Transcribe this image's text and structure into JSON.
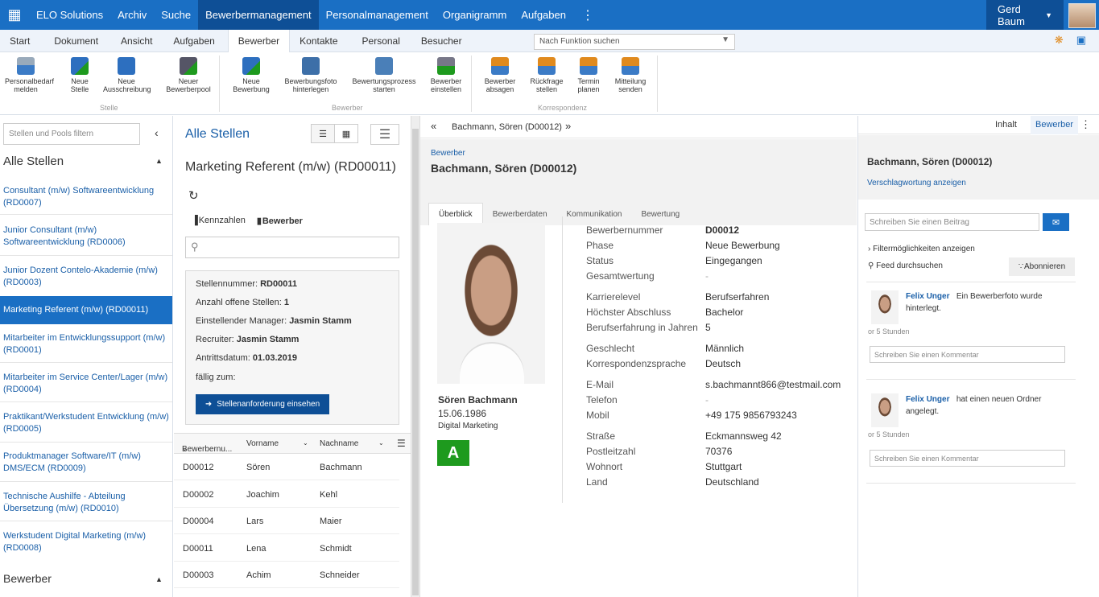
{
  "topbar": {
    "grid_icon": "apps-grid-icon",
    "nav": [
      "ELO Solutions",
      "Archiv",
      "Suche",
      "Bewerbermanagement",
      "Personalmanagement",
      "Organigramm",
      "Aufgaben"
    ],
    "active_index": 3,
    "user": "Gerd Baum"
  },
  "ribbon_tabs": [
    "Start",
    "Dokument",
    "Ansicht",
    "Aufgaben",
    "Bewerber",
    "Kontakte",
    "Personal",
    "Besucher"
  ],
  "ribbon_active_index": 4,
  "function_search": {
    "placeholder": "Nach Funktion suchen"
  },
  "ribbon": {
    "buttons": [
      {
        "label": "Personalbedarf melden",
        "icon": "person-request-icon"
      },
      {
        "label": "Neue Stelle",
        "icon": "new-position-icon"
      },
      {
        "label": "Neue Ausschreibung",
        "icon": "new-posting-icon"
      },
      {
        "label": "Neuer Bewerberpool",
        "icon": "new-pool-icon"
      },
      {
        "label": "Neue Bewerbung",
        "icon": "new-application-icon"
      },
      {
        "label": "Bewerbungsfoto hinterlegen",
        "icon": "photo-icon"
      },
      {
        "label": "Bewertungsprozess starten",
        "icon": "rating-process-icon"
      },
      {
        "label": "Bewerber einstellen",
        "icon": "hire-icon"
      },
      {
        "label": "Bewerber absagen",
        "icon": "reject-icon"
      },
      {
        "label": "Rückfrage stellen",
        "icon": "question-icon"
      },
      {
        "label": "Termin planen",
        "icon": "calendar-icon"
      },
      {
        "label": "Mitteilung senden",
        "icon": "message-icon"
      }
    ],
    "groups": [
      "Stelle",
      "Bewerber",
      "Korrespondenz"
    ]
  },
  "left": {
    "filter_placeholder": "Stellen und Pools filtern",
    "header": "Alle Stellen",
    "items": [
      "Consultant (m/w) Softwareentwicklung (RD0007)",
      "Junior Consultant (m/w) Softwareentwicklung (RD0006)",
      "Junior Dozent Contelo-Akademie (m/w) (RD0003)",
      "Marketing Referent (m/w) (RD00011)",
      "Mitarbeiter im Entwicklungssupport (m/w) (RD0001)",
      "Mitarbeiter im Service Center/Lager (m/w) (RD0004)",
      "Praktikant/Werkstudent Entwicklung (m/w) (RD0005)",
      "Produktmanager Software/IT (m/w) DMS/ECM (RD0009)",
      "Technische Aushilfe - Abteilung Übersetzung (m/w) (RD0010)",
      "Werkstudent Digital Marketing (m/w) (RD0008)"
    ],
    "selected_index": 3,
    "footer_header": "Bewerber"
  },
  "middle": {
    "title": "Alle Stellen",
    "job_title": "Marketing Referent (m/w) (RD00011)",
    "link_kennzahlen": "Kennzahlen",
    "link_bewerber": "Bewerber",
    "card": {
      "stellennummer_label": "Stellennummer:",
      "stellennummer": "RD00011",
      "offene_label": "Anzahl offene Stellen:",
      "offene": "1",
      "manager_label": "Einstellender Manager:",
      "manager": "Jasmin Stamm",
      "recruiter_label": "Recruiter:",
      "recruiter": "Jasmin Stamm",
      "antritt_label": "Antrittsdatum:",
      "antritt": "01.03.2019",
      "faellig_label": "fällig zum:",
      "button": "Stellenanforderung einsehen"
    },
    "table": {
      "headers": [
        "Bewerbernu...",
        "Vorname",
        "Nachname"
      ],
      "rows": [
        [
          "D00012",
          "Sören",
          "Bachmann"
        ],
        [
          "D00002",
          "Joachim",
          "Kehl"
        ],
        [
          "D00004",
          "Lars",
          "Maier"
        ],
        [
          "D00011",
          "Lena",
          "Schmidt"
        ],
        [
          "D00003",
          "Achim",
          "Schneider"
        ]
      ]
    }
  },
  "main": {
    "nav_title": "Bachmann, Sören (D00012)",
    "kind": "Bewerber",
    "name": "Bachmann, Sören (D00012)",
    "tabs": [
      "Überblick",
      "Bewerberdaten",
      "Kommunikation",
      "Bewertung"
    ],
    "person_name": "Sören Bachmann",
    "dob": "15.06.1986",
    "dept": "Digital Marketing",
    "grade": "A",
    "grade_color": "#1e9a1e",
    "fields": [
      {
        "label": "Bewerbernummer",
        "value": "D00012",
        "bold": true
      },
      {
        "label": "Phase",
        "value": "Neue Bewerbung"
      },
      {
        "label": "Status",
        "value": "Eingegangen"
      },
      {
        "label": "Gesamtwertung",
        "value": "-"
      },
      {
        "label": "Karrierelevel",
        "value": "Berufserfahren"
      },
      {
        "label": "Höchster Abschluss",
        "value": "Bachelor"
      },
      {
        "label": "Berufserfahrung in Jahren",
        "value": "5"
      },
      {
        "label": "Geschlecht",
        "value": "Männlich"
      },
      {
        "label": "Korrespondenzsprache",
        "value": "Deutsch"
      },
      {
        "label": "E-Mail",
        "value": "s.bachmannt866@testmail.com"
      },
      {
        "label": "Telefon",
        "value": "-"
      },
      {
        "label": "Mobil",
        "value": "+49 175 9856793243"
      },
      {
        "label": "Straße",
        "value": "Eckmannsweg 42"
      },
      {
        "label": "Postleitzahl",
        "value": "70376"
      },
      {
        "label": "Wohnort",
        "value": "Stuttgart"
      },
      {
        "label": "Land",
        "value": "Deutschland"
      }
    ]
  },
  "right": {
    "tab_inhalt": "Inhalt",
    "tab_bewerber": "Bewerber",
    "name": "Bachmann, Sören (D00012)",
    "tags_link": "Verschlagwortung anzeigen",
    "post_placeholder": "Schreiben Sie einen Beitrag",
    "filter_text": "Filtermöglichkeiten anzeigen",
    "search_text": "Feed durchsuchen",
    "subscribe": "Abonnieren",
    "feed": [
      {
        "author": "Felix Unger",
        "text": "Ein Bewerberfoto wurde hinterlegt.",
        "time": "or 5 Stunden",
        "comment_placeholder": "Schreiben Sie einen Kommentar"
      },
      {
        "author": "Felix Unger",
        "text": "hat einen neuen Ordner angelegt.",
        "time": "or 5 Stunden",
        "comment_placeholder": "Schreiben Sie einen Kommentar"
      }
    ]
  }
}
